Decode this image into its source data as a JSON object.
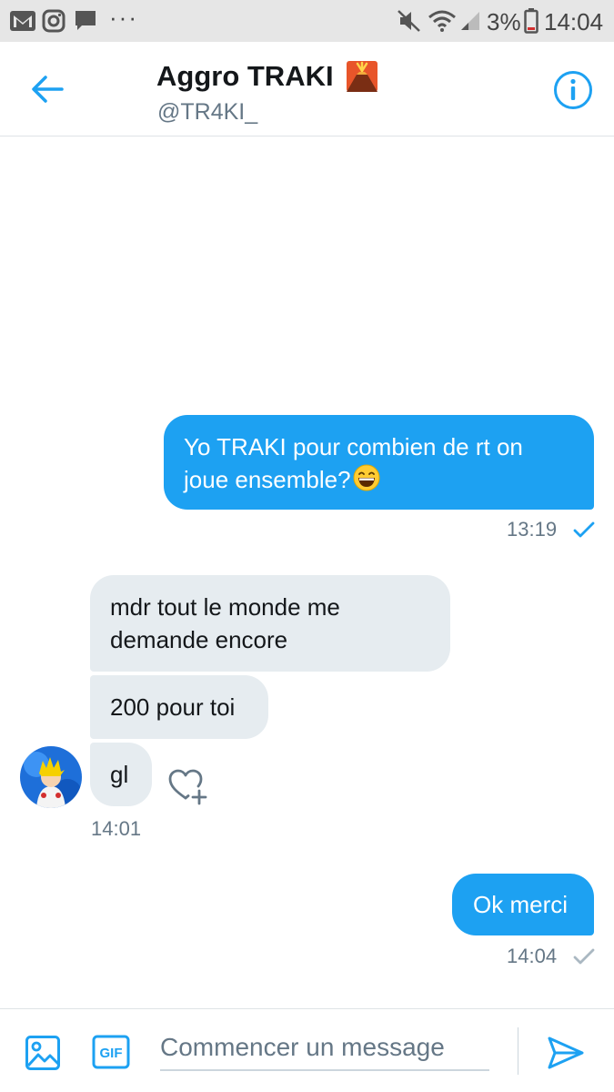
{
  "status_bar": {
    "battery_percent": "3%",
    "time": "14:04",
    "overflow_dots": "···"
  },
  "header": {
    "contact_name": "Aggro TRAKI",
    "contact_handle": "@TR4KI_"
  },
  "messages": [
    {
      "direction": "sent",
      "text": "Yo TRAKI pour combien de rt on joue ensemble?",
      "line1": "Yo TRAKI pour combien de rt on",
      "line2": "joue ensemble?",
      "emoji": "grinning-squinting-face",
      "time": "13:19",
      "status": "read"
    },
    {
      "direction": "received",
      "line1": "mdr tout le monde me",
      "line2": "demande encore"
    },
    {
      "direction": "received",
      "text": "200 pour toi"
    },
    {
      "direction": "received",
      "text": "gl",
      "time": "14:01"
    },
    {
      "direction": "sent",
      "text": "Ok merci",
      "time": "14:04",
      "status": "sent"
    }
  ],
  "composer": {
    "placeholder": "Commencer un message",
    "gif_label": "GIF"
  },
  "colors": {
    "accent": "#1da1f2",
    "received_bubble": "#e6ecf0",
    "secondary_text": "#657786",
    "status_bar_bg": "#e6e6e6"
  },
  "icons": [
    "gmail-icon",
    "instagram-icon",
    "message-icon",
    "mute-icon",
    "wifi-icon",
    "signal-icon",
    "battery-icon",
    "back-arrow-icon",
    "volcano-emoji-icon",
    "info-icon",
    "grin-emoji-icon",
    "read-check-icon",
    "avatar",
    "heart-add-icon",
    "sent-check-icon",
    "image-icon",
    "gif-icon",
    "send-icon"
  ]
}
